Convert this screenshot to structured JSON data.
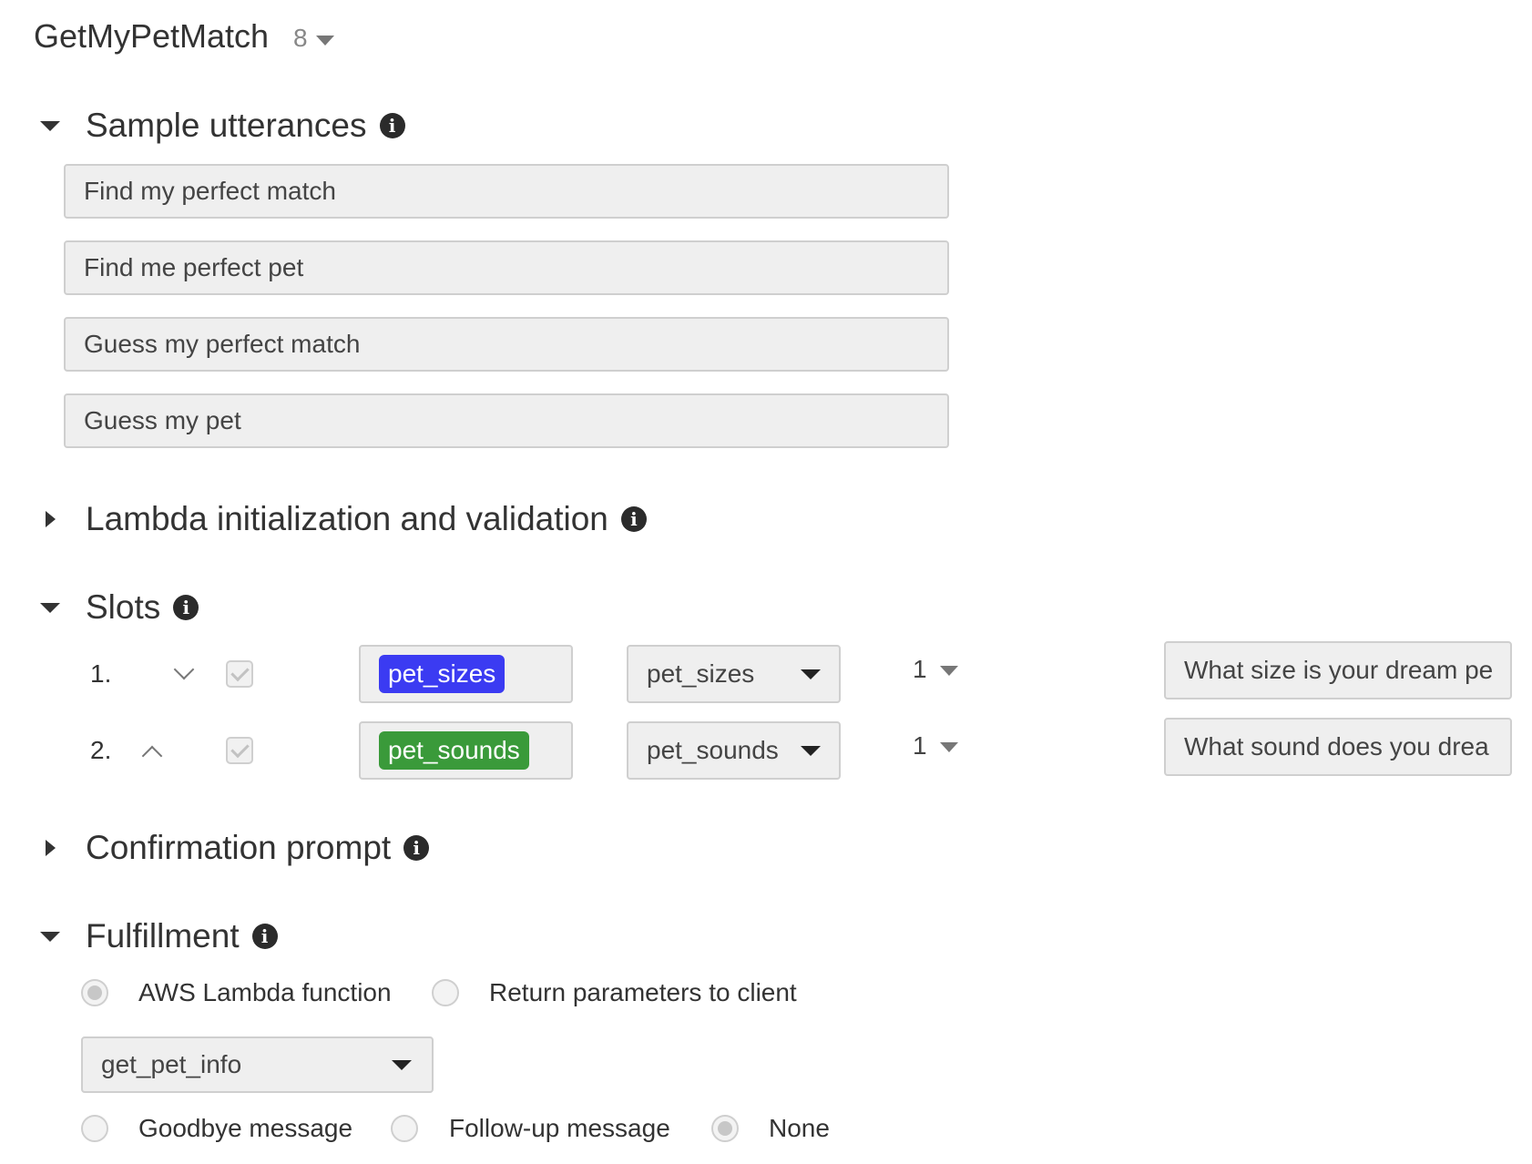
{
  "intent": {
    "name": "GetMyPetMatch",
    "version": "8"
  },
  "sections": {
    "sample_utterances": {
      "title": "Sample utterances",
      "expanded": true
    },
    "lambda_init": {
      "title": "Lambda initialization and validation",
      "expanded": false
    },
    "slots": {
      "title": "Slots",
      "expanded": true
    },
    "confirmation": {
      "title": "Confirmation prompt",
      "expanded": false
    },
    "fulfillment": {
      "title": "Fulfillment",
      "expanded": true
    }
  },
  "utterances": [
    "Find my perfect match",
    "Find me perfect pet",
    "Guess my perfect match",
    "Guess my pet"
  ],
  "slots": [
    {
      "index": "1.",
      "required": true,
      "name": "pet_sizes",
      "tag_color": "#3b3bf2",
      "type": "pet_sizes",
      "version": "1",
      "prompt": "What size is your dream pe"
    },
    {
      "index": "2.",
      "required": true,
      "name": "pet_sounds",
      "tag_color": "#3a9a3a",
      "type": "pet_sounds",
      "version": "1",
      "prompt": "What sound does you drea"
    }
  ],
  "fulfillment": {
    "options": [
      "AWS Lambda function",
      "Return parameters to client"
    ],
    "selected": "AWS Lambda function",
    "lambda_function": "get_pet_info",
    "response_options": [
      "Goodbye message",
      "Follow-up message",
      "None"
    ],
    "response_selected": "None"
  }
}
